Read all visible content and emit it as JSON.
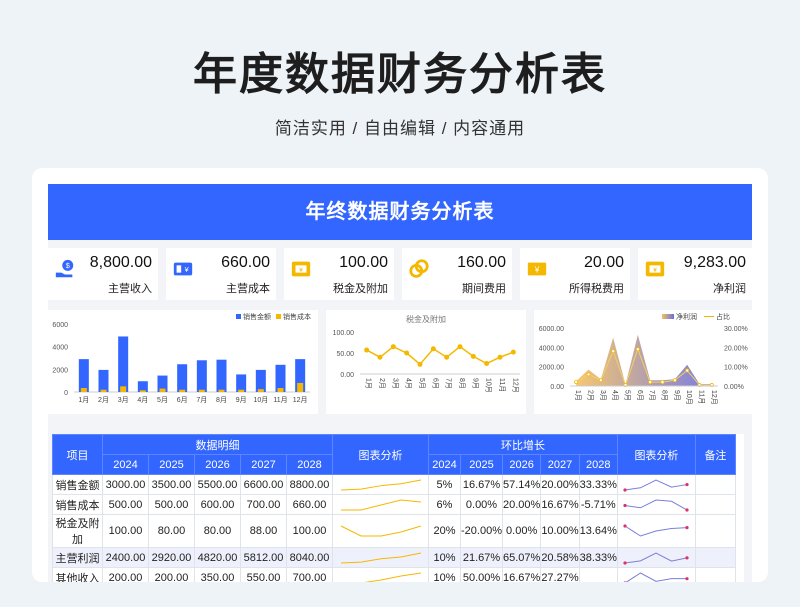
{
  "page": {
    "title": "年度数据财务分析表",
    "subtitle": "简洁实用 / 自由编辑 / 内容通用"
  },
  "banner": {
    "title": "年终数据财务分析表"
  },
  "kpis": [
    {
      "value": "8,800.00",
      "label": "主营收入",
      "icon": "hand-coin-icon"
    },
    {
      "value": "660.00",
      "label": "主营成本",
      "icon": "ticket-yen-icon"
    },
    {
      "value": "100.00",
      "label": "税金及附加",
      "icon": "money-frame-icon"
    },
    {
      "value": "160.00",
      "label": "期间费用",
      "icon": "coins-icon"
    },
    {
      "value": "20.00",
      "label": "所得税费用",
      "icon": "banknote-yen-icon"
    },
    {
      "value": "9,283.00",
      "label": "净利润",
      "icon": "money-frame-icon"
    }
  ],
  "colors": {
    "blue": "#3366ff",
    "yellow": "#f5b800",
    "purple": "#7b7fd6"
  },
  "chart_data": [
    {
      "type": "bar",
      "categories": [
        "1月",
        "2月",
        "3月",
        "4月",
        "5月",
        "6月",
        "7月",
        "8月",
        "9月",
        "10月",
        "11月",
        "12月"
      ],
      "series": [
        {
          "name": "销售金额",
          "values": [
            2900,
            1950,
            4900,
            950,
            1450,
            2450,
            2800,
            2850,
            1550,
            1950,
            2400,
            2900
          ]
        },
        {
          "name": "销售成本",
          "values": [
            350,
            200,
            500,
            150,
            300,
            200,
            200,
            200,
            200,
            250,
            350,
            800
          ]
        }
      ],
      "ylim": [
        0,
        6000
      ],
      "yticks": [
        "6000",
        "4000",
        "2000",
        "0"
      ],
      "legend": "top-right"
    },
    {
      "type": "line",
      "title": "税金及附加",
      "categories": [
        "1月",
        "2月",
        "3月",
        "4月",
        "5月",
        "6月",
        "7月",
        "8月",
        "9月",
        "10月",
        "11月",
        "12月"
      ],
      "values": [
        57,
        40,
        65,
        50,
        23,
        60,
        40,
        65,
        42,
        25,
        40,
        52
      ],
      "ylim": [
        0,
        100
      ],
      "yticks": [
        "100.00",
        "50.00",
        "0.00"
      ]
    },
    {
      "type": "area",
      "categories": [
        "1月",
        "2月",
        "3月",
        "4月",
        "5月",
        "6月",
        "7月",
        "8月",
        "9月",
        "10月",
        "11月",
        "12月"
      ],
      "series": [
        {
          "name": "净利润",
          "values": [
            500,
            1700,
            700,
            5000,
            150,
            5300,
            600,
            600,
            700,
            2200,
            200,
            200
          ]
        },
        {
          "name": "占比",
          "values": [
            0.02,
            0.06,
            0.03,
            0.18,
            0.005,
            0.19,
            0.02,
            0.02,
            0.03,
            0.08,
            0.005,
            0.005
          ]
        }
      ],
      "ylim": [
        0,
        6000
      ],
      "y2lim": [
        0,
        0.3
      ],
      "yticks": [
        "6000.00",
        "4000.00",
        "2000.00",
        "0.00"
      ],
      "y2ticks": [
        "30.00%",
        "20.00%",
        "10.00%",
        "0.00%"
      ],
      "legend": "top-right"
    }
  ],
  "table": {
    "header_item": "项目",
    "header_detail": "数据明细",
    "header_chart": "图表分析",
    "header_growth": "环比增长",
    "header_chart2": "图表分析",
    "header_note": "备注",
    "years": [
      "2024",
      "2025",
      "2026",
      "2027",
      "2028"
    ],
    "growth_years": [
      "2024",
      "2025",
      "2026",
      "2027",
      "2028"
    ],
    "rows": [
      {
        "name": "销售金额",
        "values": [
          "3000.00",
          "3500.00",
          "5500.00",
          "6600.00",
          "8800.00"
        ],
        "growth": [
          "5%",
          "16.67%",
          "57.14%",
          "20.00%",
          "33.33%"
        ],
        "spark": [
          3000,
          3500,
          5500,
          6600,
          8800
        ],
        "spark2": [
          5,
          16.67,
          57.14,
          20,
          33.33
        ]
      },
      {
        "name": "销售成本",
        "values": [
          "500.00",
          "500.00",
          "600.00",
          "700.00",
          "660.00"
        ],
        "growth": [
          "6%",
          "0.00%",
          "20.00%",
          "16.67%",
          "-5.71%"
        ],
        "spark": [
          500,
          500,
          600,
          700,
          660
        ],
        "spark2": [
          6,
          0,
          20,
          16.67,
          -5.71
        ]
      },
      {
        "name": "税金及附加",
        "values": [
          "100.00",
          "80.00",
          "80.00",
          "88.00",
          "100.00"
        ],
        "growth": [
          "20%",
          "-20.00%",
          "0.00%",
          "10.00%",
          "13.64%"
        ],
        "spark": [
          100,
          80,
          80,
          88,
          100
        ],
        "spark2": [
          20,
          -20,
          0,
          10,
          13.64
        ]
      },
      {
        "name": "主营利润",
        "values": [
          "2400.00",
          "2920.00",
          "4820.00",
          "5812.00",
          "8040.00"
        ],
        "growth": [
          "10%",
          "21.67%",
          "65.07%",
          "20.58%",
          "38.33%"
        ],
        "spark": [
          2400,
          2920,
          4820,
          5812,
          8040
        ],
        "spark2": [
          10,
          21.67,
          65.07,
          20.58,
          38.33
        ]
      },
      {
        "name": "其他收入",
        "values": [
          "200.00",
          "200.00",
          "350.00",
          "550.00",
          "700.00"
        ],
        "growth": [
          "10%",
          "50.00%",
          "16.67%",
          "27.27%",
          ""
        ],
        "spark": [
          200,
          200,
          350,
          550,
          700
        ],
        "spark2": [
          10,
          50,
          16.67,
          27.27,
          27.27
        ]
      }
    ]
  }
}
